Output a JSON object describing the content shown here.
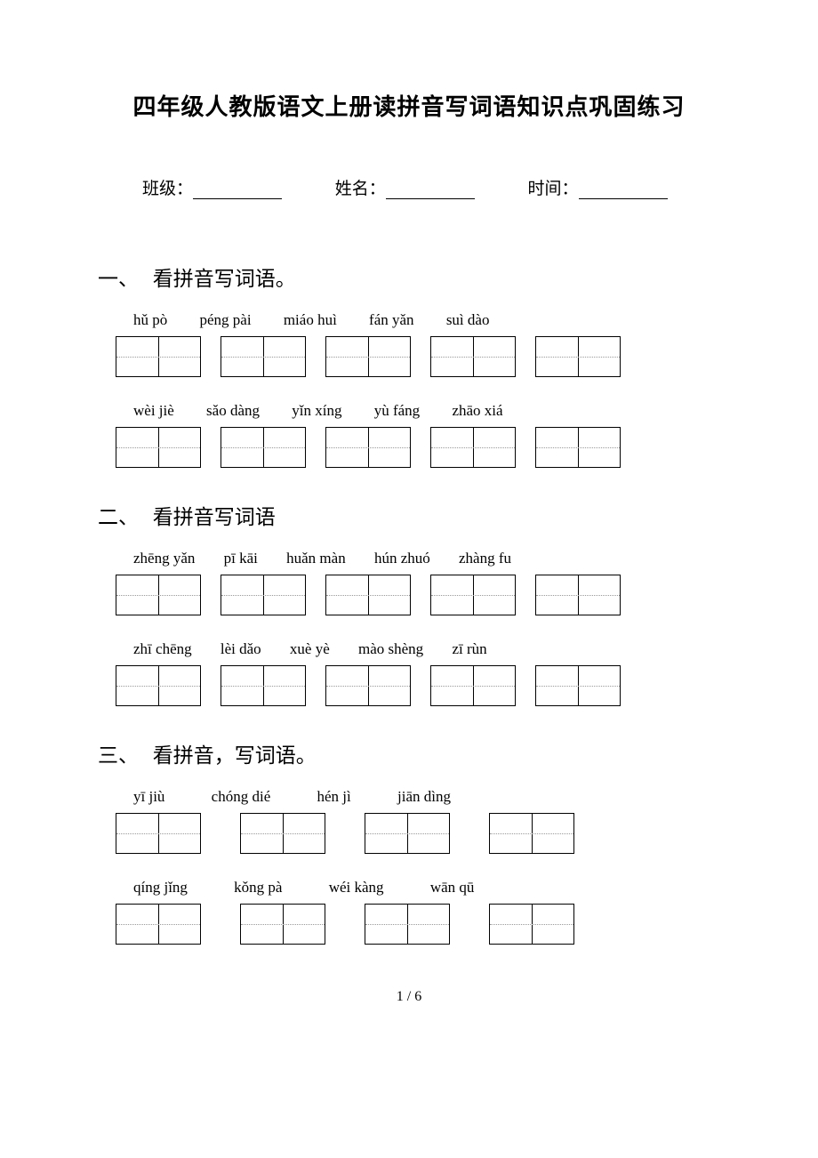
{
  "title": "四年级人教版语文上册读拼音写词语知识点巩固练习",
  "info": {
    "class_label": "班级：",
    "name_label": "姓名：",
    "time_label": "时间："
  },
  "sections": [
    {
      "num": "一、",
      "heading": "看拼音写词语。",
      "rows": [
        {
          "pinyin": [
            "hǔ pò",
            "péng pài",
            "miáo huì",
            "fán yǎn",
            "suì dào"
          ],
          "boxes": 5
        },
        {
          "pinyin": [
            "wèi jiè",
            "sǎo dàng",
            "yǐn xíng",
            "yù fáng",
            "zhāo xiá"
          ],
          "boxes": 5
        }
      ]
    },
    {
      "num": "二、",
      "heading": "看拼音写词语",
      "rows": [
        {
          "pinyin": [
            "zhēng yǎn",
            "pī kāi",
            "huǎn màn",
            "hún zhuó",
            "zhàng fu"
          ],
          "boxes": 5
        },
        {
          "pinyin": [
            "zhī chēng",
            "lèi dǎo",
            "xuè yè",
            "mào shèng",
            "zī rùn"
          ],
          "boxes": 5
        }
      ]
    },
    {
      "num": "三、",
      "heading": "看拼音，写词语。",
      "rows": [
        {
          "pinyin": [
            "yī jiù",
            "chóng dié",
            "hén jì",
            "jiān dìng"
          ],
          "boxes": 4,
          "spacing": "wide"
        },
        {
          "pinyin": [
            "qíng jǐng",
            "kǒng pà",
            "wéi kàng",
            "wān qū"
          ],
          "boxes": 4,
          "spacing": "wide"
        }
      ]
    }
  ],
  "page_footer": "1 / 6"
}
